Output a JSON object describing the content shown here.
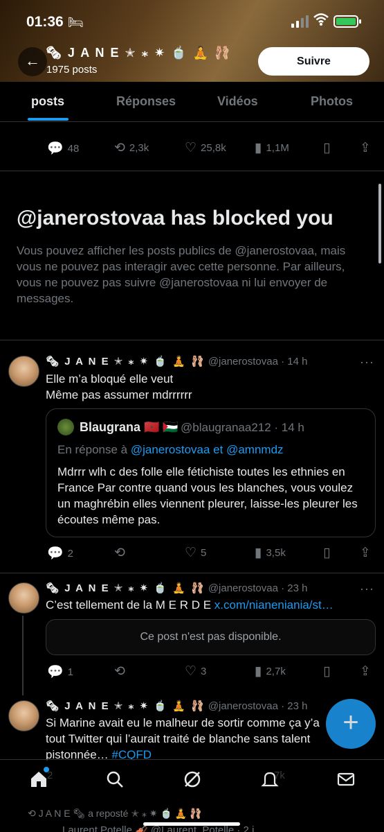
{
  "status_bar": {
    "time": "01:36",
    "bed_icon": "bed-icon",
    "wifi_icon": "wifi-icon",
    "battery_icon": "battery-icon"
  },
  "profile": {
    "name": "🗞 J A N E ✭ ⁎ ✷ 🍵 🧘 🩰",
    "posts_count": "1975 posts",
    "follow_label": "Suivre",
    "back_icon": "back-arrow-icon"
  },
  "tabs": [
    {
      "label": "posts",
      "active": true
    },
    {
      "label": "Réponses",
      "active": false
    },
    {
      "label": "Vidéos",
      "active": false
    },
    {
      "label": "Photos",
      "active": false
    }
  ],
  "top_actions": {
    "replies": "48",
    "reposts": "2,3k",
    "likes": "25,8k",
    "views": "1,1M"
  },
  "blocked": {
    "title": "@janerostovaa has blocked you",
    "text": "Vous pouvez afficher les posts publics de @janerostovaa, mais vous ne pouvez pas interagir avec cette personne. Par ailleurs, vous ne pouvez pas suivre @janerostovaa ni lui envoyer de messages."
  },
  "tweets": [
    {
      "name": "🗞 J A N E ✭ ⁎ ✷ 🍵 🧘 🩰",
      "meta": "@janerostovaa · 14 h",
      "line1": "Elle m’a bloqué elle veut",
      "line2": "Même pas assumer mdrrrrrr",
      "quote": {
        "name": "Blaugrana 🇲🇦 🇵🇸",
        "meta": "@blaugranaa212 · 14 h",
        "reply_prefix": "En réponse à ",
        "reply_to": "@janerostovaa et @amnmdz",
        "text": "Mdrrr wlh c des folle elle fétichiste toutes les ethnies en France Par contre quand vous les blanches, vous voulez un maghrébin elles viennent pleurer, laisse-les pleurer les écoutes même pas."
      },
      "actions": {
        "replies": "2",
        "reposts": "",
        "likes": "5",
        "views": "3,5k"
      }
    },
    {
      "name": "🗞 J A N E ✭ ⁎ ✷ 🍵 🧘 🩰",
      "meta": "@janerostovaa · 23 h",
      "text": "C’est tellement de la  M E R D E ",
      "link": "x.com/nianeniania/st…",
      "unavailable": "Ce post n'est pas disponible.",
      "actions": {
        "replies": "1",
        "reposts": "",
        "likes": "3",
        "views": "2,7k"
      }
    },
    {
      "name": "🗞 J A N E ✭ ⁎ ✷ 🍵 🧘 🩰",
      "meta": "@janerostovaa · 23 h",
      "line1": "Si Marine avait eu le malheur de sortir comme ça y’a",
      "line2": "tout Twitter qui l’aurait traité de blanche sans talent",
      "line3_text": "pistonnée… ",
      "hashtag": "#CQFD",
      "actions": {
        "replies": "2",
        "views": "7k"
      }
    }
  ],
  "repost_line": "J A N E 🗞 a reposté ✭ ⁎ ✷ 🍵 🧘 🩰",
  "next_tweet_line": "Laurent Potelle 🎻 @Laurent_Potelle · 2 j",
  "fab_label": "+",
  "colors": {
    "accent": "#1d9bf0",
    "background": "#000000",
    "muted": "#71767b",
    "text": "#e7e9ea",
    "battery": "#34c759"
  }
}
